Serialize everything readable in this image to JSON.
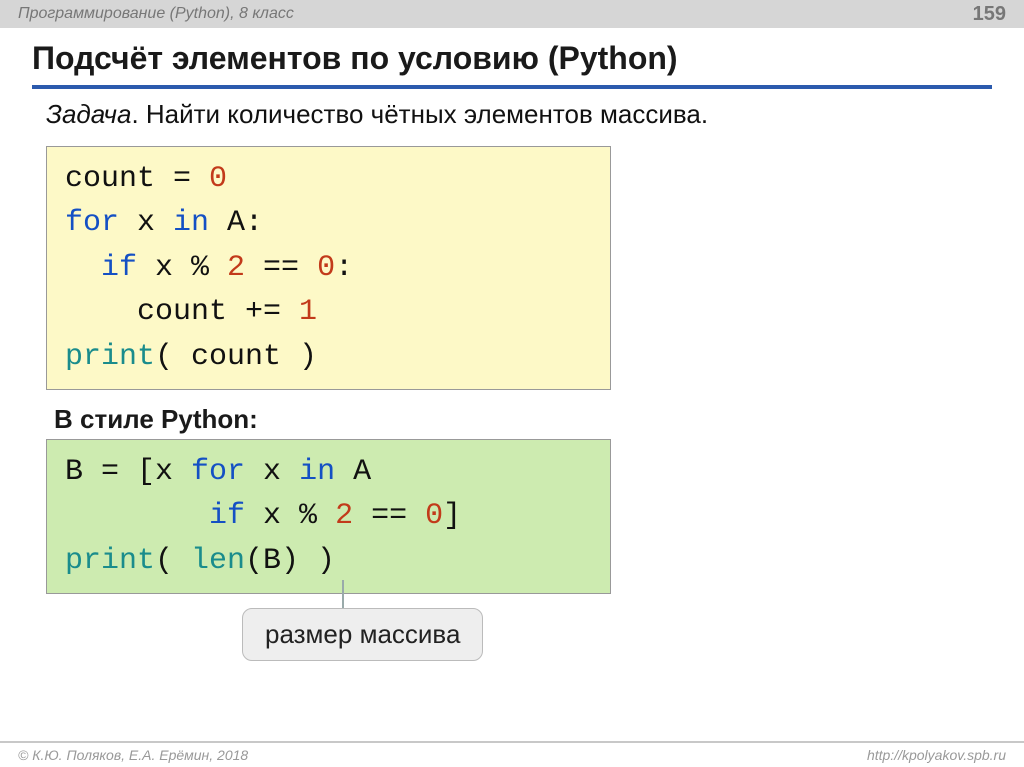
{
  "header": {
    "left": "Программирование (Python), 8 класс",
    "page": "159"
  },
  "title": "Подсчёт элементов по условию (Python)",
  "task": {
    "label": "Задача",
    "text": ". Найти количество чётных элементов массива."
  },
  "code1": {
    "l1a": "count = ",
    "l1b": "0",
    "l2a": "for",
    "l2b": " x ",
    "l2c": "in",
    "l2d": " A:",
    "l3a": "  if",
    "l3b": " x % ",
    "l3c": "2",
    "l3d": " == ",
    "l3e": "0",
    "l3f": ":",
    "l4a": "    count += ",
    "l4b": "1",
    "l5a": "print",
    "l5b": "( count )"
  },
  "subheading": "В стиле Python:",
  "code2": {
    "l1a": "B = [x ",
    "l1b": "for",
    "l1c": " x ",
    "l1d": "in",
    "l1e": " A",
    "l2a": "        ",
    "l2b": "if",
    "l2c": " x % ",
    "l2d": "2",
    "l2e": " == ",
    "l2f": "0",
    "l2g": "]",
    "l3a": "print",
    "l3b": "( ",
    "l3c": "len",
    "l3d": "(B) )"
  },
  "callout": "размер массива",
  "footer": {
    "left": "© К.Ю. Поляков, Е.А. Ерёмин, 2018",
    "right": "http://kpolyakov.spb.ru"
  }
}
